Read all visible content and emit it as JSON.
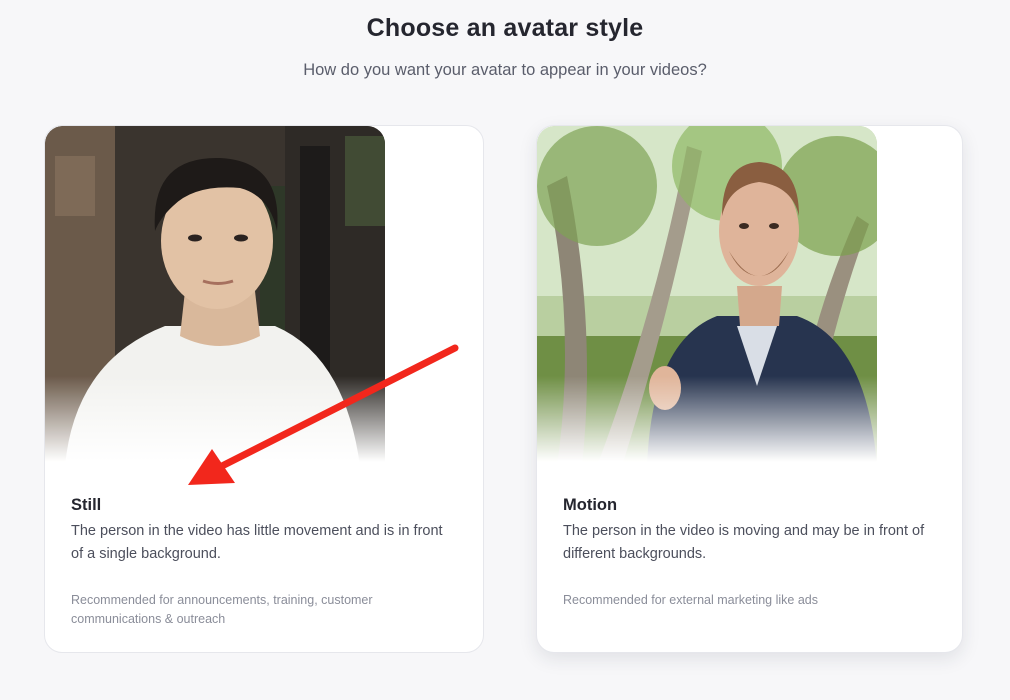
{
  "header": {
    "title": "Choose an avatar style",
    "subtitle": "How do you want your avatar to appear in your videos?"
  },
  "options": [
    {
      "title": "Still",
      "description": "The person in the video has little movement and is in front of a single background.",
      "recommendation": "Recommended for announcements, training, customer communications & outreach",
      "image": "avatar-still-photo"
    },
    {
      "title": "Motion",
      "description": "The person in the video is moving and may be in front of different backgrounds.",
      "recommendation": "Recommended for external marketing like ads",
      "image": "avatar-motion-photo"
    }
  ],
  "annotation": {
    "type": "arrow",
    "color": "#f2271c",
    "points_to": "Still"
  }
}
